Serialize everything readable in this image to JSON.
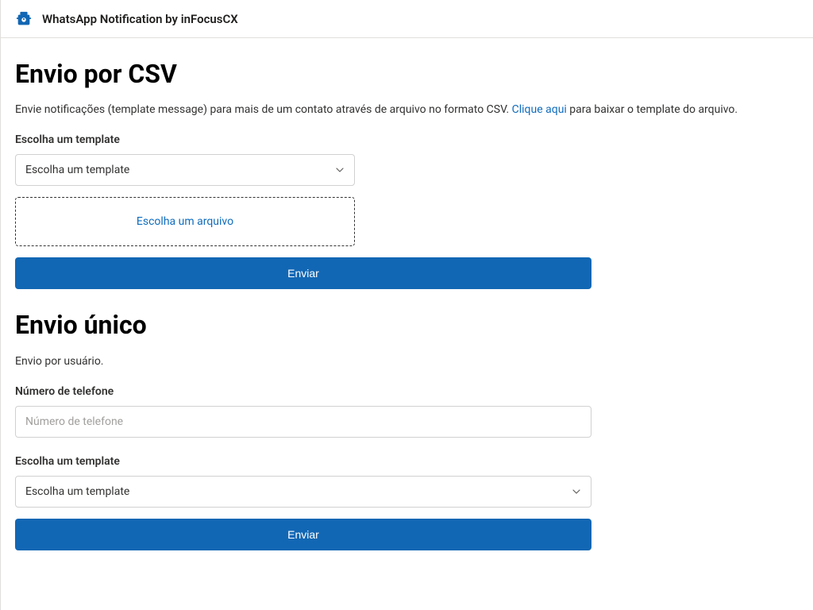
{
  "header": {
    "title": "WhatsApp Notification by inFocusCX"
  },
  "csv": {
    "heading": "Envio por CSV",
    "description_prefix": "Envie notificações (template message) para mais de um contato através de arquivo no formato CSV. ",
    "link_text": "Clique aqui",
    "description_suffix": " para baixar o template do arquivo.",
    "template_label": "Escolha um template",
    "template_placeholder": "Escolha um template",
    "file_label": "Escolha um arquivo",
    "submit": "Enviar"
  },
  "single": {
    "heading": "Envio único",
    "description": "Envio por usuário.",
    "phone_label": "Número de telefone",
    "phone_placeholder": "Número de telefone",
    "template_label": "Escolha um template",
    "template_placeholder": "Escolha um template",
    "submit": "Enviar"
  }
}
